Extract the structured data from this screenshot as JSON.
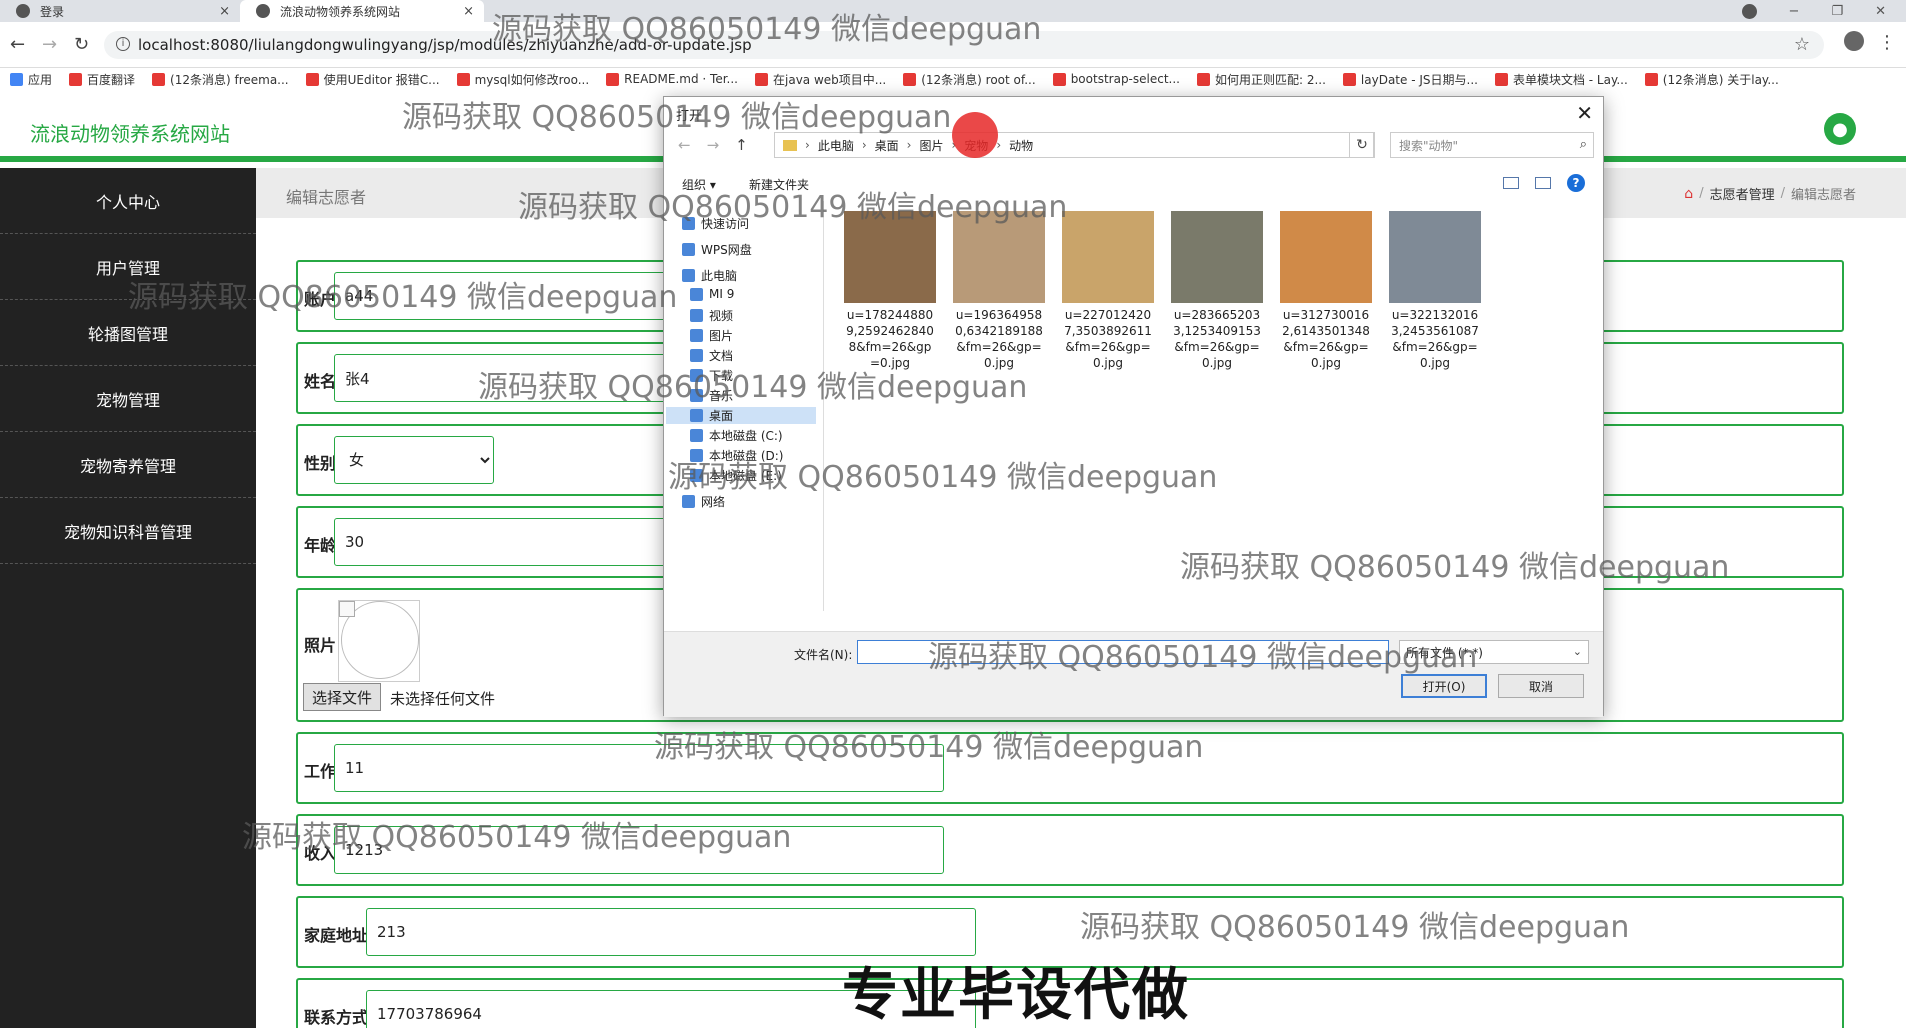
{
  "browser": {
    "tabs": [
      {
        "label": "登录",
        "close": "×"
      },
      {
        "label": "流浪动物领养系统网站",
        "close": "×"
      }
    ],
    "window_controls": {
      "minimize": "−",
      "restore": "❐",
      "close": "✕"
    },
    "url": "localhost:8080/liulangdongwulingyang/jsp/modules/zhiyuanzhe/add-or-update.jsp",
    "bookmarks": [
      "应用",
      "百度翻译",
      "(12条消息) freema...",
      "使用UEditor 报错C...",
      "mysql如何修改roo...",
      "README.md · Ter...",
      "在java web项目中...",
      "(12条消息) root of...",
      "bootstrap-select...",
      "如何用正则匹配: 2...",
      "layDate - JS日期与...",
      "表单模块文档 - Lay...",
      "(12条消息) 关于lay..."
    ]
  },
  "site": {
    "title": "流浪动物领养系统网站"
  },
  "sidebar": {
    "items": [
      "个人中心",
      "用户管理",
      "轮播图管理",
      "宠物管理",
      "宠物寄养管理",
      "宠物知识科普管理"
    ]
  },
  "breadcrumb": {
    "left": "编辑志愿者",
    "path": [
      "志愿者管理",
      "编辑志愿者"
    ],
    "sep": "/"
  },
  "form": {
    "account": {
      "label": "账户",
      "value": "a44"
    },
    "name": {
      "label": "姓名",
      "value": "张4"
    },
    "gender": {
      "label": "性别",
      "value": "女"
    },
    "age": {
      "label": "年龄",
      "value": "30"
    },
    "photo": {
      "label": "照片",
      "button": "选择文件",
      "status": "未选择任何文件"
    },
    "job": {
      "label": "工作",
      "value": "11"
    },
    "income": {
      "label": "收入",
      "value": "1213"
    },
    "address": {
      "label": "家庭地址",
      "value": "213"
    },
    "phone": {
      "label": "联系方式",
      "value": "17703786964"
    }
  },
  "dialog": {
    "title": "打开",
    "close": "✕",
    "path": [
      "此电脑",
      "桌面",
      "图片",
      "宠物",
      "动物"
    ],
    "search_placeholder": "搜索\"动物\"",
    "organize": "组织 ▾",
    "new_folder": "新建文件夹",
    "help": "?",
    "nav": [
      "快速访问",
      "WPS网盘",
      "此电脑",
      "MI 9",
      "视频",
      "图片",
      "文档",
      "下载",
      "音乐",
      "桌面",
      "本地磁盘 (C:)",
      "本地磁盘 (D:)",
      "本地磁盘 (E:)",
      "网络"
    ],
    "files": [
      {
        "name": "u=1782448809,25924628408&fm=26&gp=0.jpg",
        "color": "#8a6a4a"
      },
      {
        "name": "u=1963649580,6342189188&fm=26&gp=0.jpg",
        "color": "#b89a78"
      },
      {
        "name": "u=2270124207,3503892611&fm=26&gp=0.jpg",
        "color": "#c9a46a"
      },
      {
        "name": "u=2836652033,1253409153&fm=26&gp=0.jpg",
        "color": "#7a7a6a"
      },
      {
        "name": "u=3127300162,6143501348&fm=26&gp=0.jpg",
        "color": "#d08a48"
      },
      {
        "name": "u=3221320163,2453561087&fm=26&gp=0.jpg",
        "color": "#7f8a96"
      }
    ],
    "filename_label": "文件名(N):",
    "filename_value": "",
    "filetype": "所有文件 (*.*)",
    "open_button": "打开(O)",
    "cancel_button": "取消"
  },
  "watermark": "源码获取 QQ86050149 微信deepguan",
  "promo": "专业毕设代做",
  "colors": {
    "accent": "#27a844",
    "sidebar": "#222222"
  }
}
